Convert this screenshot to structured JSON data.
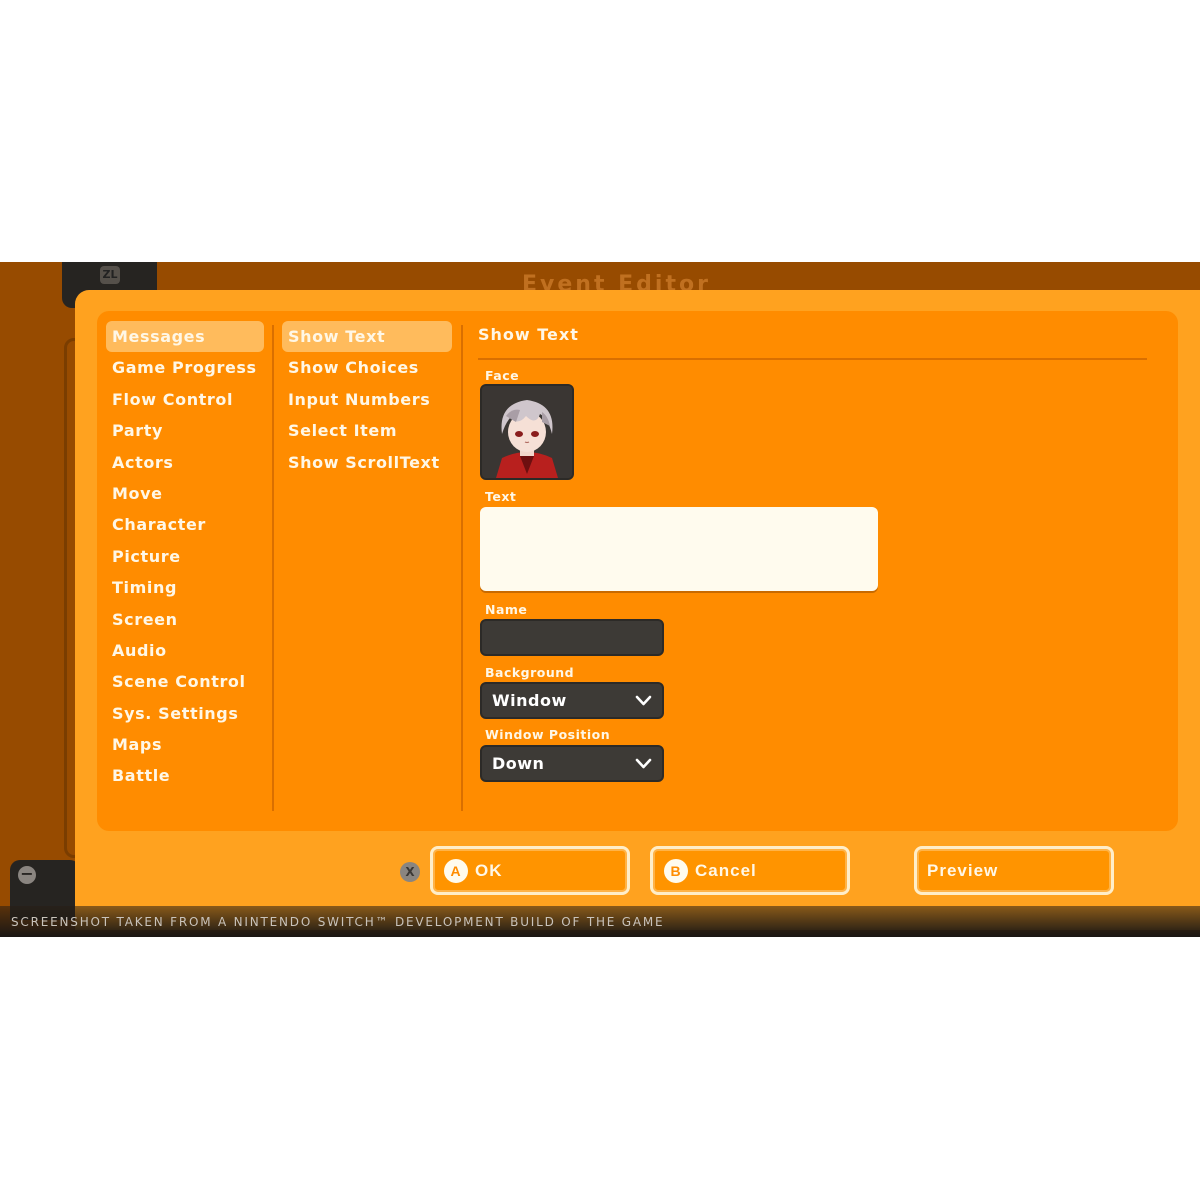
{
  "window": {
    "title": "Event Editor"
  },
  "background": {
    "zl_button": "ZL",
    "minus_button": "−"
  },
  "categories": [
    {
      "label": "Messages",
      "selected": true
    },
    {
      "label": "Game Progress",
      "selected": false
    },
    {
      "label": "Flow Control",
      "selected": false
    },
    {
      "label": "Party",
      "selected": false
    },
    {
      "label": "Actors",
      "selected": false
    },
    {
      "label": "Move",
      "selected": false
    },
    {
      "label": "Character",
      "selected": false
    },
    {
      "label": "Picture",
      "selected": false
    },
    {
      "label": "Timing",
      "selected": false
    },
    {
      "label": "Screen",
      "selected": false
    },
    {
      "label": "Audio",
      "selected": false
    },
    {
      "label": "Scene Control",
      "selected": false
    },
    {
      "label": "Sys. Settings",
      "selected": false
    },
    {
      "label": "Maps",
      "selected": false
    },
    {
      "label": "Battle",
      "selected": false
    }
  ],
  "commands": [
    {
      "label": "Show Text",
      "selected": true
    },
    {
      "label": "Show Choices",
      "selected": false
    },
    {
      "label": "Input Numbers",
      "selected": false
    },
    {
      "label": "Select Item",
      "selected": false
    },
    {
      "label": "Show ScrollText",
      "selected": false
    }
  ],
  "pane": {
    "title": "Show Text",
    "face_label": "Face",
    "text_label": "Text",
    "text_value": "",
    "name_label": "Name",
    "name_value": "",
    "background_label": "Background",
    "background_value": "Window",
    "position_label": "Window Position",
    "position_value": "Down"
  },
  "buttons": {
    "x_glyph": "X",
    "ok_glyph": "A",
    "ok_label": "OK",
    "cancel_glyph": "B",
    "cancel_label": "Cancel",
    "preview_label": "Preview"
  },
  "caption": "SCREENSHOT TAKEN FROM A NINTENDO SWITCH™ DEVELOPMENT BUILD OF THE GAME",
  "icons": {
    "face_portrait": "portrait-icon",
    "dropdown": "chevron-down-icon"
  },
  "colors": {
    "dialog": "#ffa21f",
    "inner_panel": "#ff8c00",
    "selected_item": "#ffbb5c",
    "dark_field": "#3d3a36",
    "text_light": "#fff7e6"
  }
}
